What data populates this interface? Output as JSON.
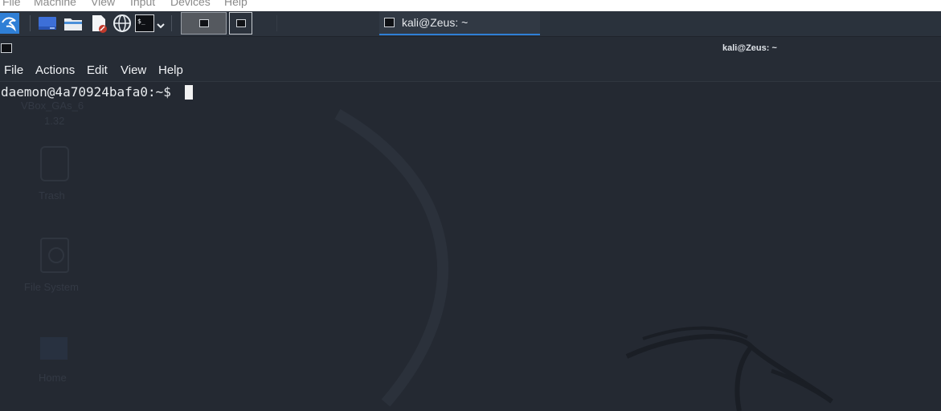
{
  "vbox_menu": {
    "items": [
      "File",
      "Machine",
      "View",
      "Input",
      "Devices",
      "Help"
    ]
  },
  "panel": {
    "launchers": [
      "kali-menu-icon",
      "desktop-icon",
      "file-manager-icon",
      "text-editor-icon",
      "web-browser-icon",
      "terminal-icon",
      "chevron-down-icon"
    ],
    "window_task_title": "kali@Zeus: ~"
  },
  "window": {
    "title": "kali@Zeus: ~",
    "menu": [
      "File",
      "Actions",
      "Edit",
      "View",
      "Help"
    ]
  },
  "terminal": {
    "prompt": "daemon@4a70924bafa0:~$ "
  },
  "desktop": {
    "icons": [
      "VBox_GAs_6",
      "1.32",
      "Trash",
      "File System",
      "Home"
    ]
  },
  "colors": {
    "panel": "#2b323c",
    "terminal_bg": "#242932",
    "accent": "#2f7fd6",
    "text": "#e8ebee"
  }
}
